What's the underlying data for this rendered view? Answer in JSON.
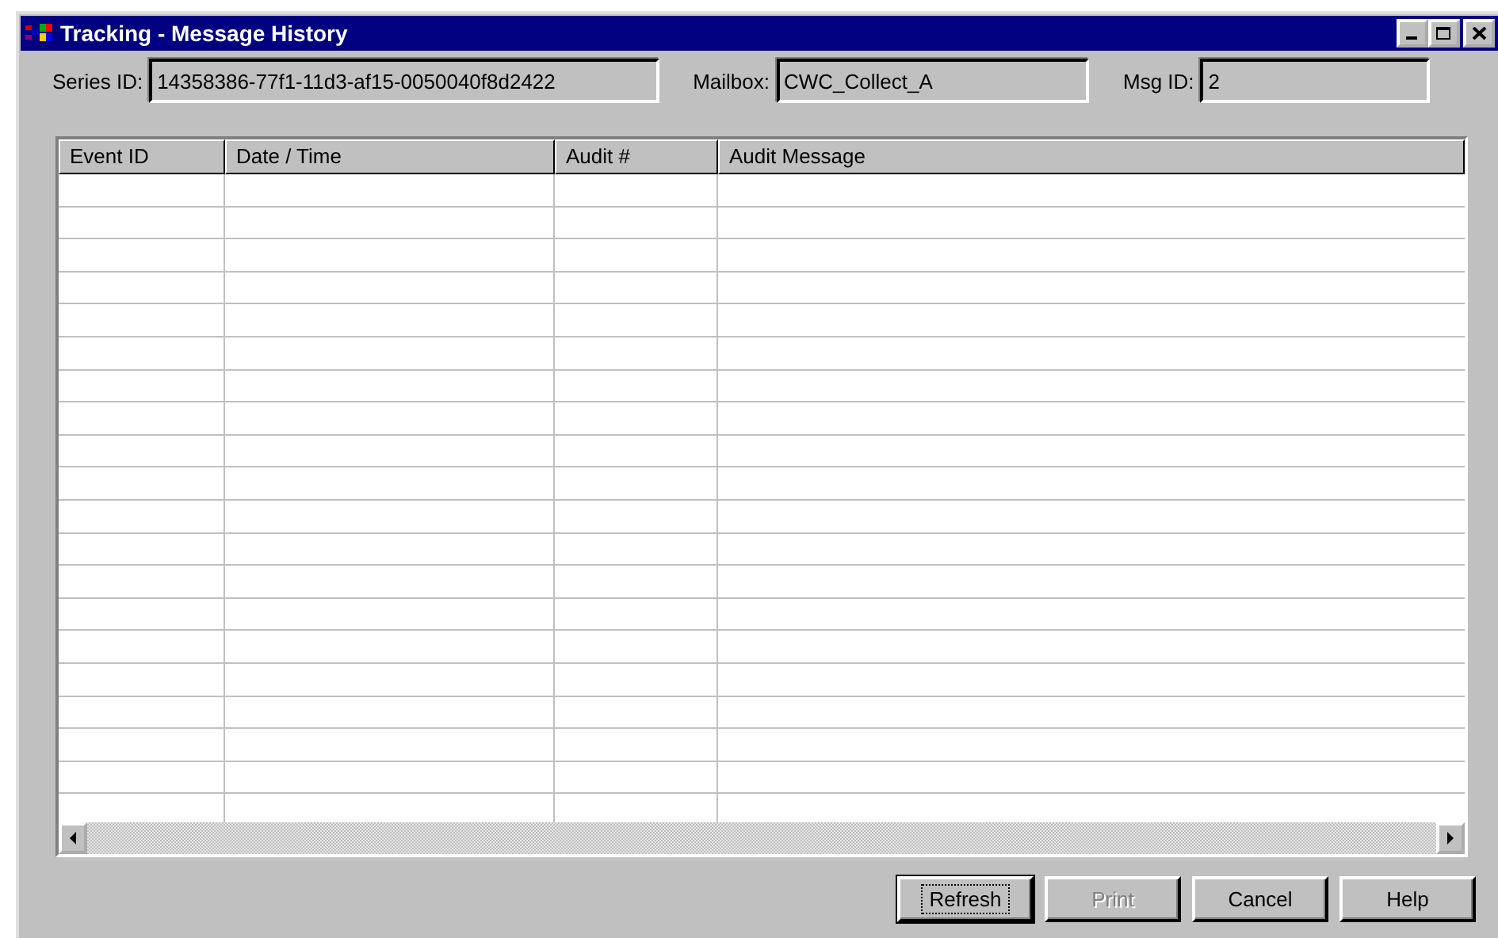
{
  "window": {
    "title": "Tracking - Message History"
  },
  "fields": [
    {
      "label": "Series ID:",
      "value": "14358386-77f1-11d3-af15-0050040f8d2422"
    },
    {
      "label": "Mailbox:",
      "value": "CWC_Collect_A"
    },
    {
      "label": "Msg ID:",
      "value": "2"
    }
  ],
  "table": {
    "columns": [
      "Event ID",
      "Date / Time",
      "Audit #",
      "Audit Message"
    ]
  },
  "buttons": [
    {
      "label": "Refresh",
      "default": true,
      "disabled": false
    },
    {
      "label": "Print",
      "default": false,
      "disabled": true
    },
    {
      "label": "Cancel",
      "default": false,
      "disabled": false
    },
    {
      "label": "Help",
      "default": false,
      "disabled": false
    }
  ]
}
